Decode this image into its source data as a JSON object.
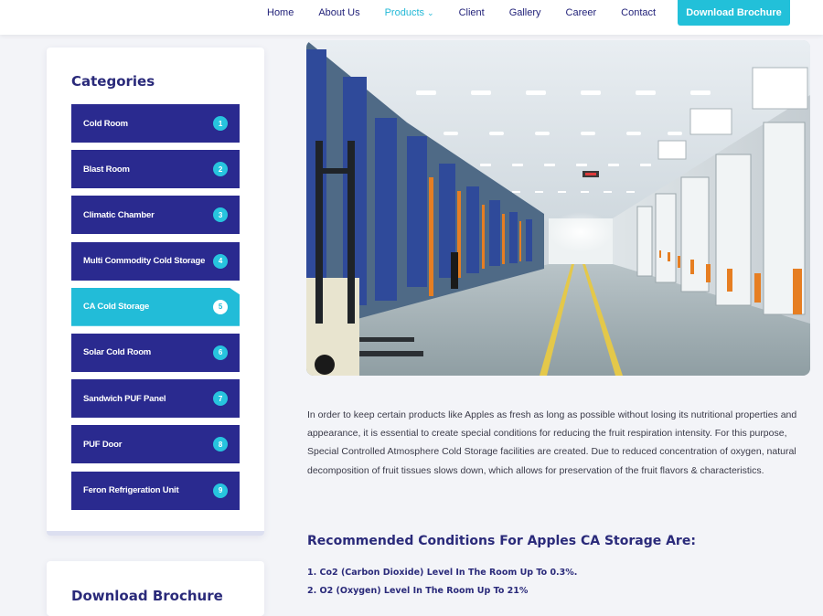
{
  "nav": {
    "items": [
      {
        "label": "Home"
      },
      {
        "label": "About Us"
      },
      {
        "label": "Products"
      },
      {
        "label": "Client"
      },
      {
        "label": "Gallery"
      },
      {
        "label": "Career"
      },
      {
        "label": "Contact"
      }
    ],
    "active": "Products",
    "brochure_button": "Download Brochure"
  },
  "sidebar": {
    "title": "Categories",
    "items": [
      {
        "label": "Cold Room",
        "num": "1"
      },
      {
        "label": "Blast Room",
        "num": "2"
      },
      {
        "label": "Climatic Chamber",
        "num": "3"
      },
      {
        "label": "Multi Commodity Cold Storage",
        "num": "4"
      },
      {
        "label": "CA Cold Storage",
        "num": "5"
      },
      {
        "label": "Solar Cold Room",
        "num": "6"
      },
      {
        "label": "Sandwich PUF Panel",
        "num": "7"
      },
      {
        "label": "PUF Door",
        "num": "8"
      },
      {
        "label": "Feron Refrigeration Unit",
        "num": "9"
      }
    ],
    "active": "CA Cold Storage"
  },
  "sidebar2": {
    "title": "Download Brochure"
  },
  "main": {
    "description": "In order to keep certain products like Apples as fresh as long as possible without losing its nutritional properties and appearance, it is essential to create special conditions for reducing the fruit respiration intensity. For this purpose, Special Controlled Atmosphere Cold Storage facilities are created. Due to reduced concentration of oxygen, natural decomposition of fruit tissues slows down, which allows for preservation of the fruit flavors & characteristics.",
    "conditions_title": "Recommended Conditions For Apples CA Storage Are:",
    "conditions": [
      "1. Co2 (Carbon Dioxide) Level In The Room Up To 0.3%.",
      "2. O2 (Oxygen) Level In The Room Up To 21%"
    ]
  },
  "colors": {
    "accent": "#22bcd8",
    "navy": "#2a2a8f",
    "heading": "#2a2a7a"
  }
}
